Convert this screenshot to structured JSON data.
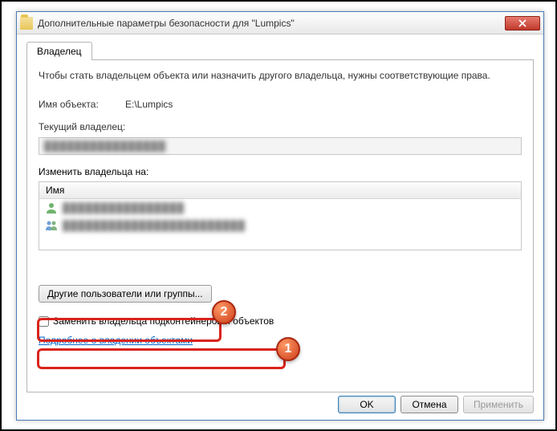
{
  "window": {
    "title": "Дополнительные параметры безопасности  для \"Lumpics\""
  },
  "tab": {
    "owner": "Владелец"
  },
  "intro": "Чтобы стать владельцем объекта или назначить другого владельца, нужны соответствующие права.",
  "object_name_label": "Имя объекта:",
  "object_name_value": "E:\\Lumpics",
  "current_owner_label": "Текущий владелец:",
  "current_owner_value": "████████████████",
  "change_owner_label": "Изменить владельца на:",
  "list": {
    "header": "Имя",
    "items": [
      {
        "text": "████████████████"
      },
      {
        "text": "████████████████████████"
      }
    ]
  },
  "other_users_btn": "Другие пользователи или группы...",
  "replace_checkbox_label": "Заменить владельца подконтейнеров и объектов",
  "learn_more_link": "Подробнее о владении объектами",
  "buttons": {
    "ok": "OK",
    "cancel": "Отмена",
    "apply": "Применить"
  },
  "annotations": {
    "badge1": "1",
    "badge2": "2"
  }
}
